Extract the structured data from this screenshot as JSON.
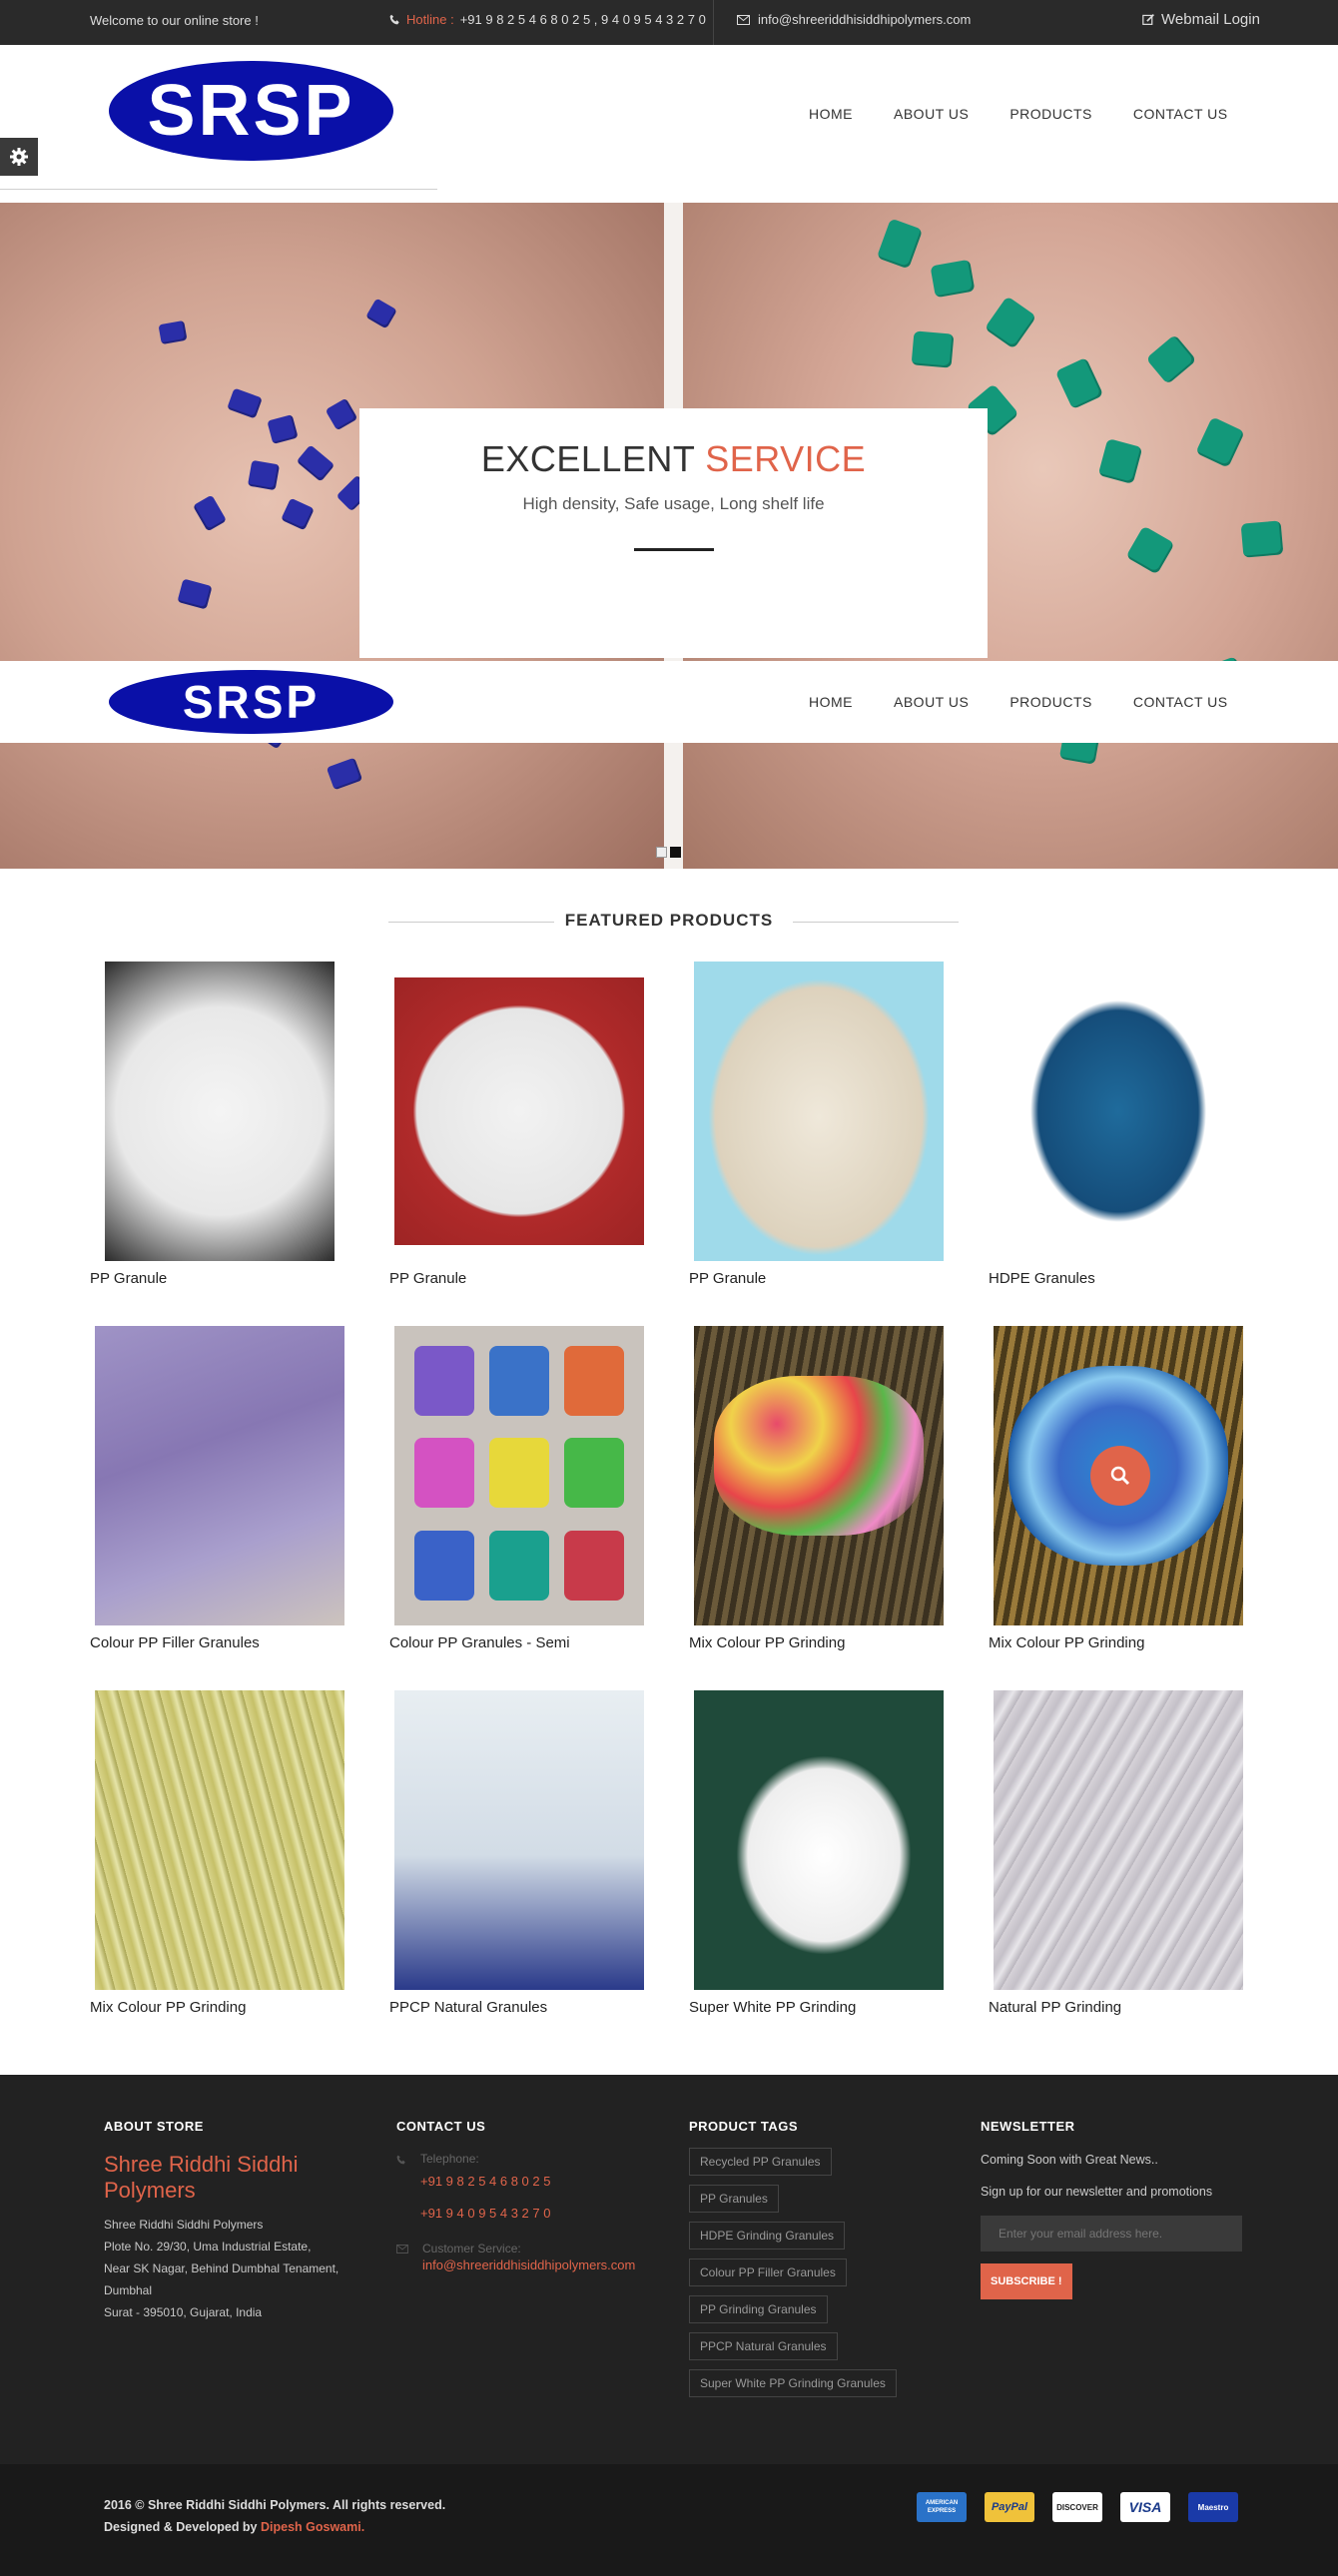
{
  "topbar": {
    "welcome": "Welcome to our online store !",
    "hotline_label": "Hotline :",
    "hotline_numbers": "+91 9 8 2 5 4 6 8 0 2 5 , 9 4 0 9 5 4 3 2 7 0",
    "email": "info@shreeriddhisiddhipolymers.com",
    "webmail": "Webmail Login"
  },
  "header": {
    "logo_text": "SRSP",
    "nav": [
      "HOME",
      "ABOUT US",
      "PRODUCTS",
      "CONTACT US"
    ]
  },
  "hero": {
    "title_main": "EXCELLENT",
    "title_accent": "SERVICE",
    "subtitle": "High density, Safe usage, Long shelf life",
    "active_slide": 2,
    "slide_count": 2
  },
  "featured": {
    "title": "FEATURED PRODUCTS",
    "products": [
      {
        "name": "PP Granule",
        "icon": "white-granules-image"
      },
      {
        "name": "PP Granule",
        "icon": "white-granules-red-bg-image"
      },
      {
        "name": "PP Granule",
        "icon": "cream-granules-blue-bg-image"
      },
      {
        "name": "HDPE Granules",
        "icon": "blue-granules-image"
      },
      {
        "name": "Colour PP Filler Granules",
        "icon": "purple-granules-image"
      },
      {
        "name": "Colour PP Granules - Semi",
        "icon": "colour-granule-bags-image"
      },
      {
        "name": "Mix Colour PP Grinding",
        "icon": "mix-colour-grinding-image"
      },
      {
        "name": "Mix Colour PP Grinding",
        "icon": "blue-grinding-image"
      },
      {
        "name": "Mix Colour PP Grinding",
        "icon": "yellow-grinding-image"
      },
      {
        "name": "PPCP Natural Granules",
        "icon": "ppcp-natural-image"
      },
      {
        "name": "Super White PP Grinding",
        "icon": "super-white-grinding-image"
      },
      {
        "name": "Natural PP Grinding",
        "icon": "natural-grinding-image"
      }
    ]
  },
  "footer": {
    "about": {
      "heading": "ABOUT STORE",
      "brand": "Shree Riddhi Siddhi Polymers",
      "address": [
        "Shree Riddhi Siddhi Polymers",
        "Plote No. 29/30, Uma Industrial Estate,",
        "Near SK Nagar, Behind Dumbhal Tenament,",
        "Dumbhal",
        "Surat - 395010, Gujarat, India"
      ]
    },
    "contact": {
      "heading": "CONTACT US",
      "telephone_label": "Telephone:",
      "phone1": "+91 9 8 2 5 4 6 8 0 2 5",
      "phone2": "+91 9 4 0 9 5 4 3 2 7 0",
      "service_label": "Customer Service:",
      "email": "info@shreeriddhisiddhipolymers.com"
    },
    "tags": {
      "heading": "PRODUCT TAGS",
      "items": [
        "Recycled PP Granules",
        "PP Granules",
        "HDPE Grinding Granules",
        "Colour PP Filler Granules",
        "PP Grinding Granules",
        "PPCP Natural Granules",
        "Super White PP Grinding Granules"
      ]
    },
    "newsletter": {
      "heading": "NEWSLETTER",
      "line1": "Coming Soon with Great News..",
      "line2": "Sign up for our newsletter and promotions",
      "placeholder": "Enter your email address here.",
      "button": "SUBSCRIBE !"
    }
  },
  "bottom": {
    "copyright": "2016 © Shree Riddhi Siddhi Polymers. All rights reserved.",
    "designed_by": "Designed & Developed by",
    "developer": "Dipesh Goswami.",
    "payments": [
      "AMERICAN EXPRESS",
      "PayPal",
      "DISCOVER",
      "VISA",
      "Maestro"
    ]
  },
  "colors": {
    "accent": "#e0644a",
    "logo_blue": "#0a10a8",
    "topbar": "#2a2a2a",
    "footer": "#222222"
  }
}
